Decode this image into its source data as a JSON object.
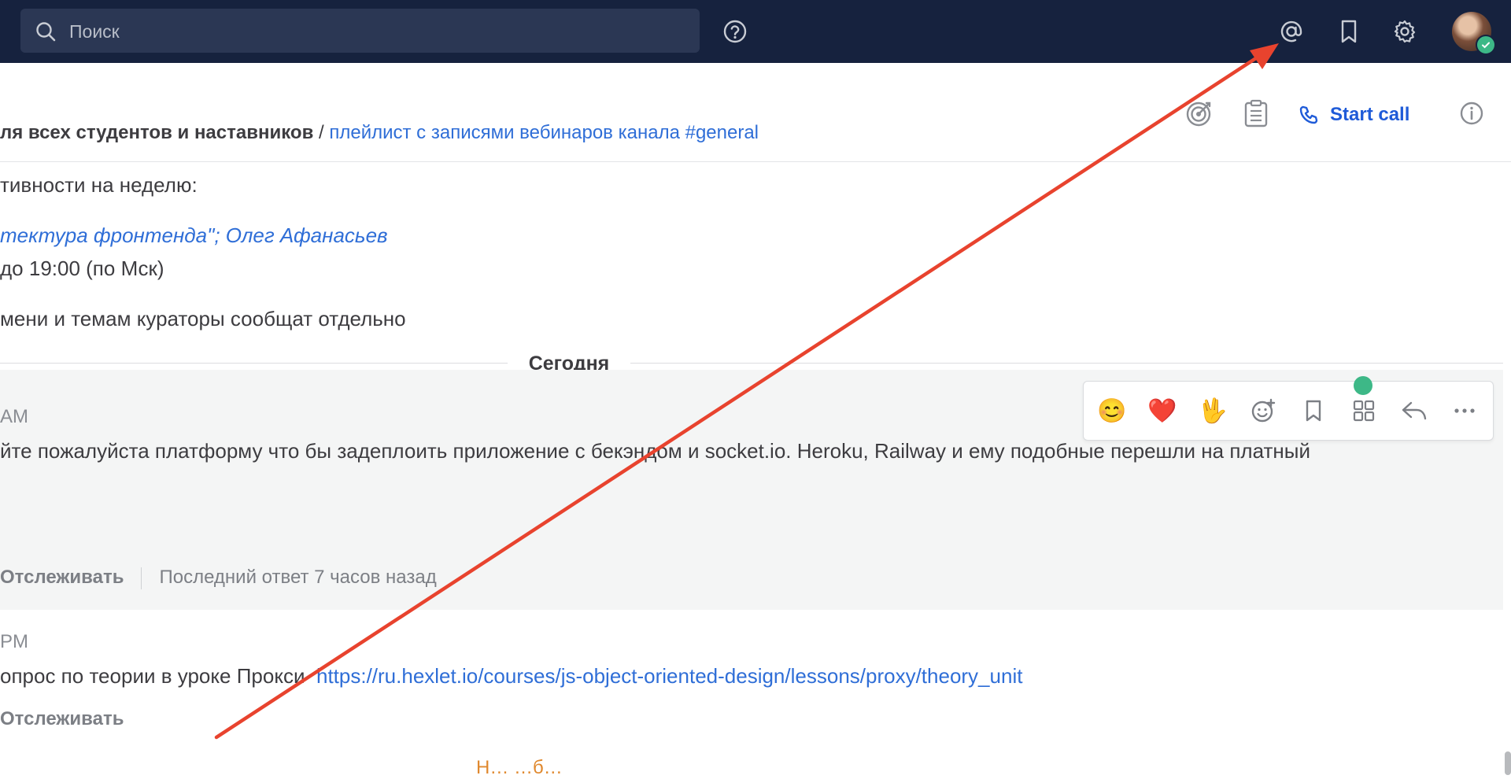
{
  "topbar": {
    "search_placeholder": "Поиск",
    "icons": [
      "search-icon",
      "help-icon",
      "mention-icon",
      "bookmark-icon",
      "gear-icon",
      "avatar"
    ]
  },
  "channel_header": {
    "purpose_bold": "ля всех студентов и наставников",
    "purpose_sep": " / ",
    "purpose_link": "плейлист с записями вебинаров канала #general",
    "start_call": "Start call"
  },
  "posts": {
    "prev_line1": "тивности на неделю:",
    "prev_line2": "тектура фронтенда\"; Олег Афанасьев",
    "prev_line3": "до 19:00 (по Мск)",
    "prev_line4": "мени и темам кураторы сообщат отдельно",
    "date_separator": "Сегодня",
    "post1_time": "AM",
    "post1_text": "йте пожалуйста платформу что бы задеплоить приложение с бекэндом и socket.io. Heroku, Railway и ему подобные перешли на платный",
    "post1_follow": "Отслеживать",
    "post1_last_reply": "Последний ответ 7 часов назад",
    "post2_time": " PM",
    "post2_text": "опрос по теории в уроке Прокси",
    "post2_url": "https://ru.hexlet.io/courses/js-object-oriented-design/lessons/proxy/theory_unit",
    "post2_follow": "Отслеживать",
    "bottom_hint": "Н…   …б…"
  },
  "colors": {
    "topbar": "#16223e",
    "link": "#2f6ed7",
    "arrow": "#e8432e",
    "online": "#3db887"
  }
}
